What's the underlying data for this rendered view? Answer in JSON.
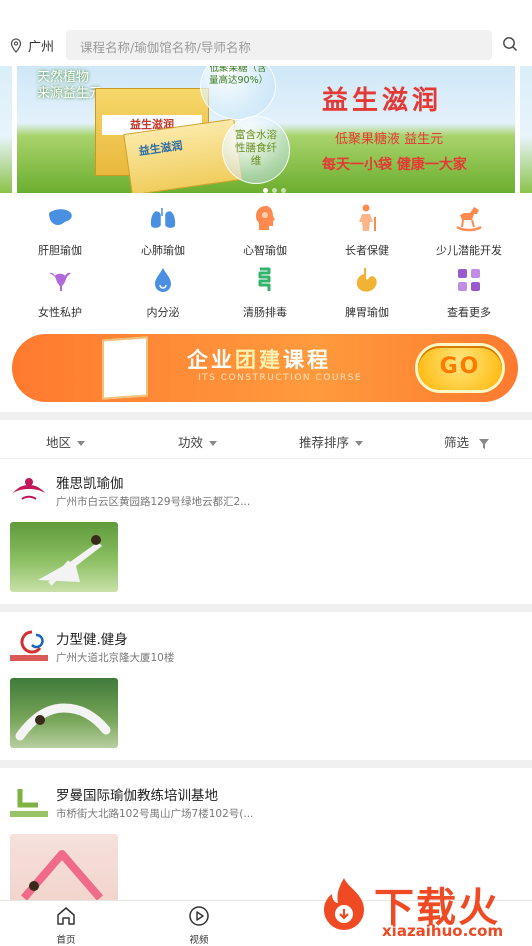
{
  "location": {
    "city": "广州"
  },
  "search": {
    "placeholder": "课程名称/瑜伽馆名称/导师名称"
  },
  "banner": {
    "tag_line1": "天然植物",
    "tag_line2": "来源益生元",
    "bubble1": "低聚果糖（含量高达90%）",
    "bubble2": "富含水溶性膳食纤维",
    "box_label": "益生滋润",
    "title": "益生滋润",
    "sub1": "低聚果糖液 益生元",
    "sub2": "每天一小袋 健康一大家"
  },
  "categories": [
    {
      "label": "肝胆瑜伽",
      "icon": "liver-icon",
      "color": "#4a90e2"
    },
    {
      "label": "心肺瑜伽",
      "icon": "lungs-icon",
      "color": "#4a90e2"
    },
    {
      "label": "心智瑜伽",
      "icon": "head-icon",
      "color": "#ff8a50"
    },
    {
      "label": "长者保健",
      "icon": "elder-icon",
      "color": "#ff8a50"
    },
    {
      "label": "少儿潜能开发",
      "icon": "rocking-horse-icon",
      "color": "#ff8a50"
    },
    {
      "label": "女性私护",
      "icon": "uterus-icon",
      "color": "#b06bd8"
    },
    {
      "label": "内分泌",
      "icon": "drop-icon",
      "color": "#4a90e2"
    },
    {
      "label": "清肠排毒",
      "icon": "intestine-icon",
      "color": "#33b36b"
    },
    {
      "label": "脾胃瑜伽",
      "icon": "stomach-icon",
      "color": "#f2b233"
    },
    {
      "label": "查看更多",
      "icon": "grid-more-icon",
      "color": "#9b59d0"
    }
  ],
  "promo": {
    "title_a": "企业",
    "title_b": "团建",
    "title_c": "课程",
    "subtitle": "ITS CONSTRUCTION COURSE",
    "go": "GO"
  },
  "filters": [
    {
      "label": "地区"
    },
    {
      "label": "功效"
    },
    {
      "label": "推荐排序"
    },
    {
      "label": "筛选"
    }
  ],
  "venues": [
    {
      "name": "雅思凯瑜伽",
      "address": "广州市白云区黄园路129号绿地云都汇2..."
    },
    {
      "name": "力型健.健身",
      "address": "广州大道北京隆大厦10楼"
    },
    {
      "name": "罗曼国际瑜伽教练培训基地",
      "address": "市桥街大北路102号禺山广场7楼102号(..."
    }
  ],
  "tabs": [
    {
      "label": "首页",
      "icon": "home-icon"
    },
    {
      "label": "视频",
      "icon": "play-icon"
    }
  ],
  "watermark": {
    "text": "下载火",
    "url": "xiazaihuo.com"
  }
}
